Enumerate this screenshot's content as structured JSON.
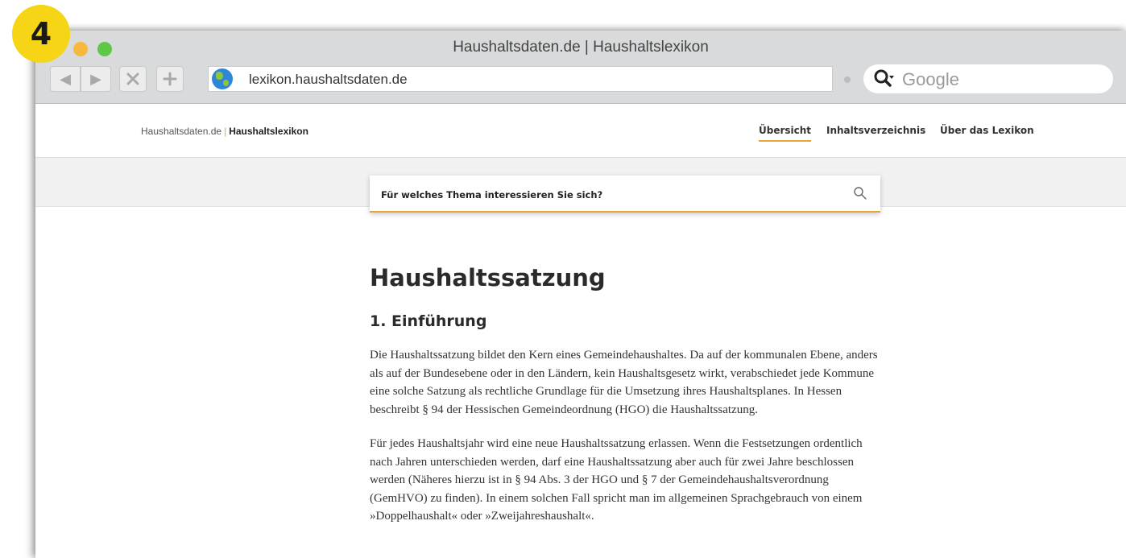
{
  "badge": {
    "number": "4"
  },
  "window": {
    "title": "Haushaltsdaten.de | Haushaltslexikon",
    "url": "lexikon.haushaltsdaten.de",
    "search_placeholder": "Google"
  },
  "site": {
    "brand_prefix": "Haushaltsdaten.de",
    "brand_separator": "|",
    "brand_name": "Haushaltslexikon",
    "nav": [
      {
        "label": "Übersicht",
        "active": true
      },
      {
        "label": "Inhaltsverzeichnis",
        "active": false
      },
      {
        "label": "Über das Lexikon",
        "active": false
      }
    ],
    "accent_color": "#e8a33a"
  },
  "topic_search": {
    "placeholder": "Für welches Thema interessieren Sie sich?"
  },
  "article": {
    "title": "Haushaltssatzung",
    "section_heading": "1. Einführung",
    "paragraphs": [
      "Die Haushaltssatzung bildet den Kern eines Gemeindehaushaltes. Da auf der kommunalen Ebene, anders als auf der Bundesebene oder in den Ländern, kein Haushaltsgesetz wirkt, verabschiedet jede Kommune eine solche Satzung als rechtliche Grundlage für die Umsetzung ihres Haushaltsplanes. In Hessen beschreibt § 94 der Hessischen Gemeindeordnung (HGO) die Haushaltssatzung.",
      "Für jedes Haushaltsjahr wird eine neue Haushaltssatzung erlassen. Wenn die Festsetzungen ordentlich nach Jahren unterschieden werden, darf eine Haushaltssatzung aber auch für zwei Jahre beschlossen werden (Näheres hierzu ist in § 94 Abs. 3 der HGO und § 7 der Gemeindehaushaltsverordnung (GemHVO) zu finden). In einem solchen Fall spricht man im allgemeinen Sprachgebrauch von einem »Doppelhaushalt« oder »Zweijahreshaushalt«."
    ]
  }
}
